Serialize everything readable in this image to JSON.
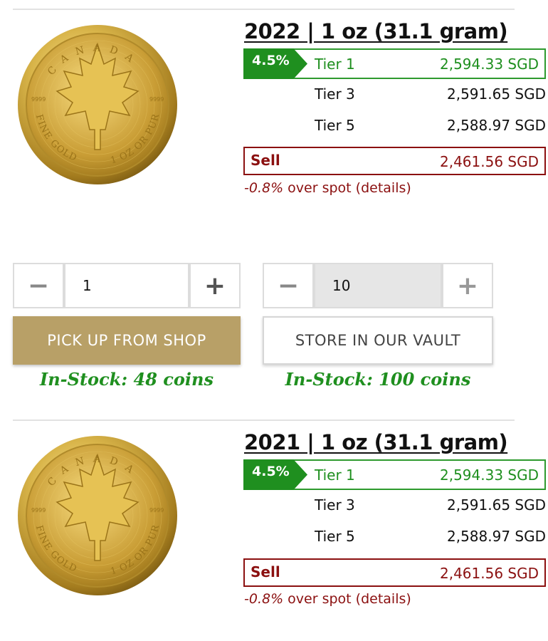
{
  "products": [
    {
      "title": "2022 | 1 oz (31.1 gram)",
      "coin_texts": {
        "country": "CANADA",
        "fine_gold": "FINE GOLD",
        "oz": "1 OZ OR PUR",
        "purity_left": "9999",
        "purity_right": "9999"
      },
      "badge": "4.5%",
      "tier1": {
        "label": "Tier 1",
        "price": "2,594.33 SGD"
      },
      "tier3": {
        "label": "Tier 3",
        "price": "2,591.65 SGD"
      },
      "tier5": {
        "label": "Tier 5",
        "price": "2,588.97 SGD"
      },
      "sell": {
        "label": "Sell",
        "price": "2,461.56 SGD"
      },
      "spot": {
        "pct": "-0.8%",
        "text": " over spot (details)"
      }
    },
    {
      "title": "2021 | 1 oz (31.1 gram)",
      "coin_texts": {
        "country": "CANADA",
        "fine_gold": "FINE GOLD",
        "oz": "1 OZ OR PUR",
        "purity_left": "9999",
        "purity_right": "9999"
      },
      "badge": "4.5%",
      "tier1": {
        "label": "Tier 1",
        "price": "2,594.33 SGD"
      },
      "tier3": {
        "label": "Tier 3",
        "price": "2,591.65 SGD"
      },
      "tier5": {
        "label": "Tier 5",
        "price": "2,588.97 SGD"
      },
      "sell": {
        "label": "Sell",
        "price": "2,461.56 SGD"
      },
      "spot": {
        "pct": "-0.8%",
        "text": " over spot (details)"
      }
    }
  ],
  "pickup": {
    "minus": "−",
    "quantity": "1",
    "plus": "+",
    "button_label": "PICK UP FROM SHOP",
    "stock": "In-Stock: 48 coins"
  },
  "vault": {
    "minus": "−",
    "quantity": "10",
    "plus": "+",
    "button_label": "STORE IN OUR VAULT",
    "stock": "In-Stock: 100 coins"
  },
  "colors": {
    "green": "#1f8f1f",
    "dark_red": "#8b1010",
    "gold_button": "#b8a067",
    "gold_coin": "#d4af37"
  }
}
